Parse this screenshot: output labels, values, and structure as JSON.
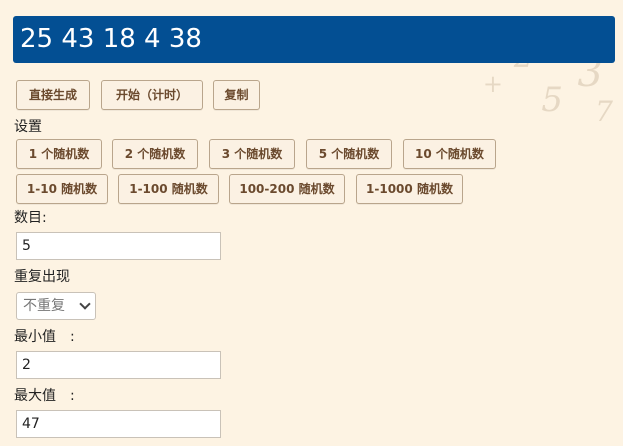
{
  "result": {
    "text": "25 43 18 4 38"
  },
  "actions": {
    "generate": "直接生成",
    "start": "开始（计时）",
    "copy": "复制"
  },
  "settings": {
    "heading": "设置",
    "count_presets": [
      "1 个随机数",
      "2 个随机数",
      "3 个随机数",
      "5 个随机数",
      "10 个随机数"
    ],
    "range_presets": [
      "1-10 随机数",
      "1-100 随机数",
      "100-200 随机数",
      "1-1000 随机数"
    ]
  },
  "form": {
    "count_label": "数目:",
    "count_value": "5",
    "repeat_label": "重复出现",
    "repeat_selected": "不重复",
    "min_label": "最小值　:",
    "min_value": "2",
    "max_label": "最大值　:",
    "max_value": "47"
  }
}
